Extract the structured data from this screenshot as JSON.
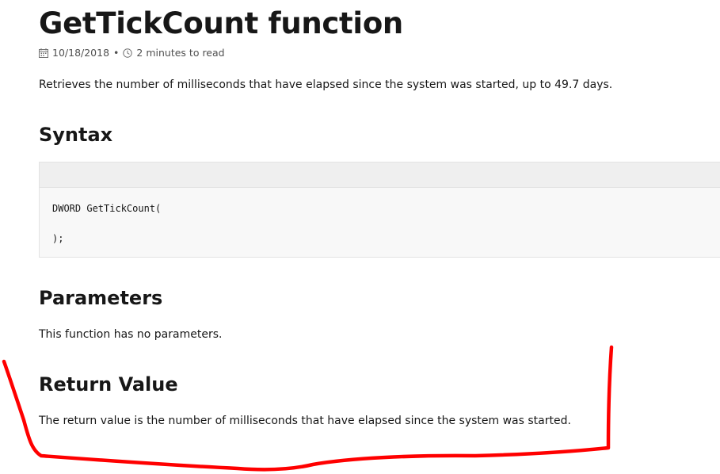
{
  "title": "GetTickCount function",
  "meta": {
    "date": "10/18/2018",
    "separator": "•",
    "read_time": "2 minutes to read",
    "calendar_icon": "calendar-icon",
    "clock_icon": "clock-icon"
  },
  "intro": "Retrieves the number of milliseconds that have elapsed since the system was started, up to 49.7 days.",
  "sections": {
    "syntax": {
      "heading": "Syntax",
      "code_line1": "DWORD GetTickCount(",
      "code_line2": "",
      "code_line3": ");"
    },
    "parameters": {
      "heading": "Parameters",
      "text": "This function has no parameters."
    },
    "return_value": {
      "heading": "Return Value",
      "text": "The return value is the number of milliseconds that have elapsed since the system was started."
    }
  },
  "annotation": {
    "color": "#ff0000"
  }
}
